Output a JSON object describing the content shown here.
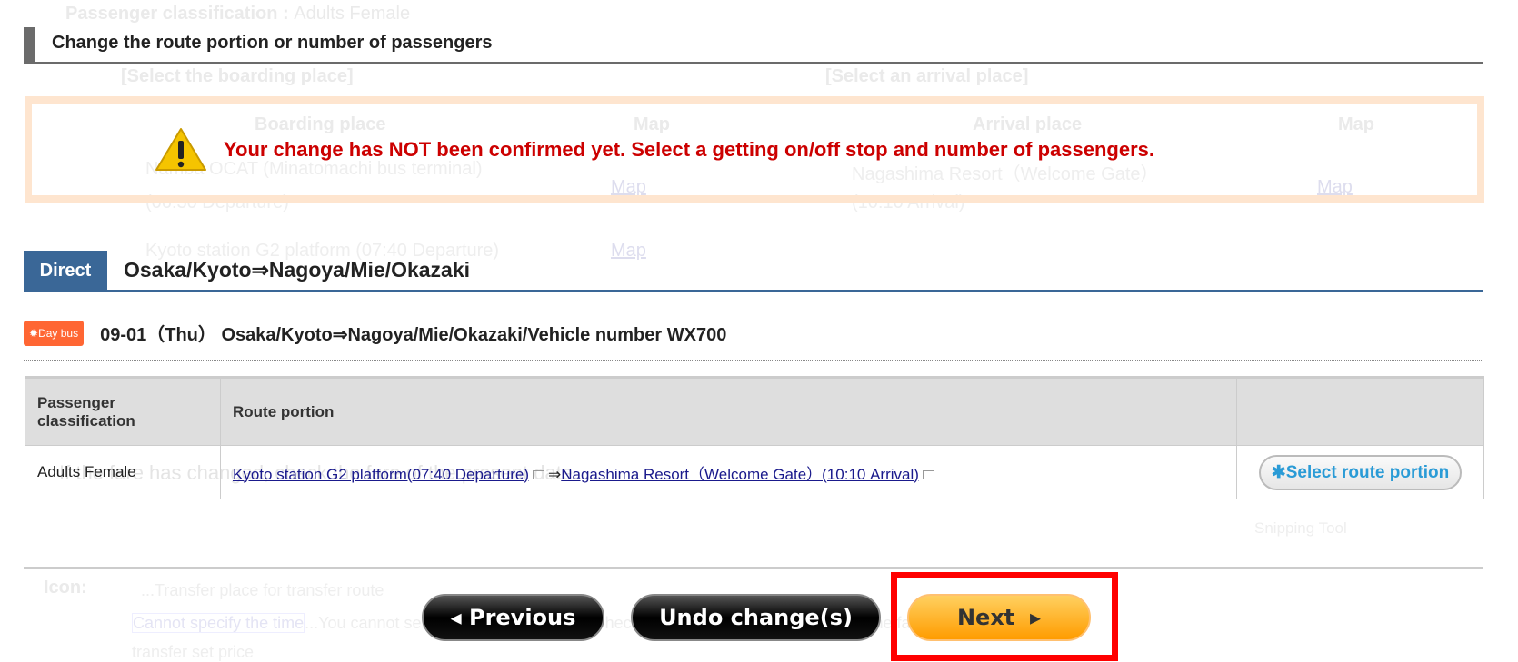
{
  "background": {
    "passenger_label": "Passenger classification :",
    "passenger_value": "Adults Female",
    "boarding_title": "[Select the boarding place]",
    "arrival_title": "[Select an arrival place]",
    "boarding_col": "Boarding place",
    "arrival_col": "Arrival place",
    "map_col": "Map",
    "boarding_1": "Namba OCAT (Minatomachi bus terminal)",
    "boarding_1_time": "(06:30 Departure)",
    "boarding_2": "Kyoto station G2 platform (07:40 Departure)",
    "arrival_1": "Nagashima Resort（Welcome Gate）",
    "arrival_1_time": "(10:10 Arrival)",
    "map_link": "Map",
    "note": "If the fare has changed, check the fare of the present date.",
    "snipping": "Snipping Tool",
    "icon_label": "Icon:",
    "icon_1": "...Transfer place for transfer route",
    "icon_2_badge": "Cannot specify the time",
    "icon_2": "...You cannot select the departure time. Check the timetable for more details. The fare is included in the",
    "icon_2_cont": "transfer set price"
  },
  "header": {
    "title": "Change the route portion or number of passengers"
  },
  "warning": {
    "icon": "warning-triangle-icon",
    "message": "Your change has NOT been confirmed yet. Select a getting on/off stop and number of passengers.",
    "color": "#cc0000"
  },
  "route": {
    "tag": "Direct",
    "title": "Osaka/Kyoto⇒Nagoya/Mie/Okazaki",
    "color": "#3a6797"
  },
  "trip": {
    "badge": "Day bus",
    "title": "09-01（Thu） Osaka/Kyoto⇒Nagoya/Mie/Okazaki/Vehicle number WX700"
  },
  "table": {
    "headers": [
      "Passenger classification",
      "Route portion",
      ""
    ],
    "rows": [
      {
        "classification": "Adults Female",
        "from": "Kyoto station G2 platform(07:40 Departure)",
        "arrow": "⇒",
        "to": "Nagashima Resort（Welcome Gate）(10:10 Arrival)",
        "action": "Select route portion"
      }
    ]
  },
  "buttons": {
    "previous": "◂ Previous",
    "undo": "Undo change(s)",
    "next": "Next  ▸"
  }
}
